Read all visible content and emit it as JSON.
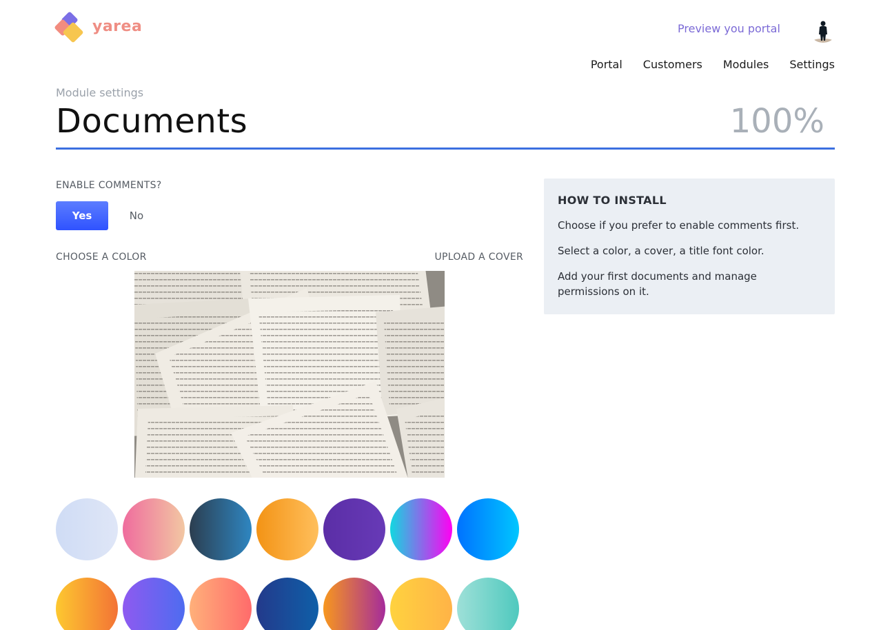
{
  "brand": {
    "name": "yarea"
  },
  "header": {
    "preview_link": "Preview you portal",
    "nav": [
      "Portal",
      "Customers",
      "Modules",
      "Settings"
    ]
  },
  "page": {
    "breadcrumb": "Module settings",
    "title": "Documents",
    "progress_text": "100%",
    "progress": 1.0
  },
  "comments": {
    "label": "ENABLE COMMENTS?",
    "yes": "Yes",
    "no": "No",
    "selected": "Yes"
  },
  "color": {
    "label": "CHOOSE A COLOR"
  },
  "cover": {
    "upload_label": "UPLOAD A COVER",
    "image": "open-book-pages-photo"
  },
  "swatches": [
    {
      "from": "#cfdcf5",
      "to": "#dfe6f7"
    },
    {
      "from": "#ef6c9e",
      "to": "#f2c7a2"
    },
    {
      "from": "#2c3e50",
      "to": "#2e86c1"
    },
    {
      "from": "#f39315",
      "to": "#ffbf5c"
    },
    {
      "from": "#5b2ea6",
      "to": "#673ab7"
    },
    {
      "from": "#12d8e0",
      "to": "#ff00f2"
    },
    {
      "from": "#0072ff",
      "to": "#00c6ff"
    },
    {
      "from": "#fdc830",
      "to": "#f37335"
    },
    {
      "from": "#8e5af0",
      "to": "#4e6cf0"
    },
    {
      "from": "#ffb07a",
      "to": "#ff6b6b"
    },
    {
      "from": "#233a8b",
      "to": "#0f5fa8"
    },
    {
      "from": "#f7971e",
      "to": "#a52c9b"
    },
    {
      "from": "#ffd23f",
      "to": "#ffb347"
    },
    {
      "from": "#9ee0d8",
      "to": "#4fc9be"
    }
  ],
  "install": {
    "title": "HOW TO INSTALL",
    "steps": [
      "Choose if you prefer to enable comments first.",
      "Select a color, a cover, a title font color.",
      "Add your first documents and manage permissions on it."
    ]
  }
}
